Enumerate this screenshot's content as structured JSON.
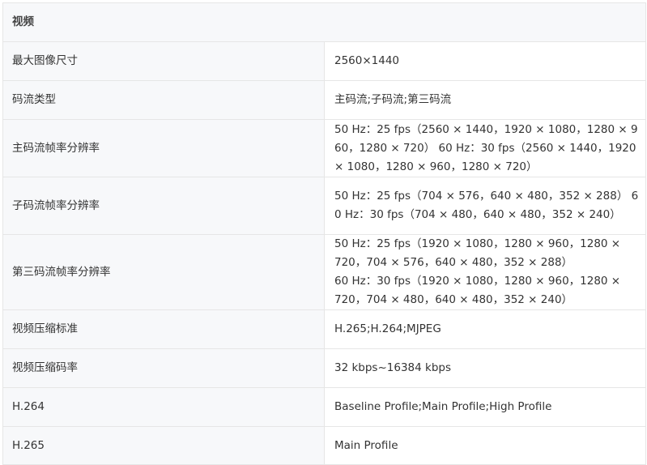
{
  "section_title": "视频",
  "rows": [
    {
      "key": "最大图像尺寸",
      "value": "2560×1440"
    },
    {
      "key": "码流类型",
      "value": "主码流;子码流;第三码流"
    },
    {
      "key": "主码流帧率分辨率",
      "value": "50 Hz：25 fps（2560 × 1440，1920 × 1080，1280 × 960，1280 × 720） 60 Hz：30 fps（2560 × 1440，1920 × 1080，1280 × 960，1280 × 720）"
    },
    {
      "key": "子码流帧率分辨率",
      "value": "50 Hz：25 fps（704 × 576，640 × 480，352 × 288） 60 Hz：30 fps（704 × 480，640 × 480，352 × 240）"
    },
    {
      "key": "第三码流帧率分辨率",
      "lines": [
        "50 Hz：25 fps（1920 × 1080，1280 × 960，1280 × 720，704 × 576，640 × 480，352 × 288）",
        "60 Hz：30 fps（1920 × 1080，1280 × 960，1280 × 720，704 × 480，640 × 480，352 × 240）"
      ]
    },
    {
      "key": "视频压缩标准",
      "value": "H.265;H.264;MJPEG"
    },
    {
      "key": "视频压缩码率",
      "value": "32 kbps~16384 kbps"
    },
    {
      "key": "H.264",
      "value": "Baseline Profile;Main Profile;High Profile"
    },
    {
      "key": "H.265",
      "value": "Main Profile"
    }
  ]
}
